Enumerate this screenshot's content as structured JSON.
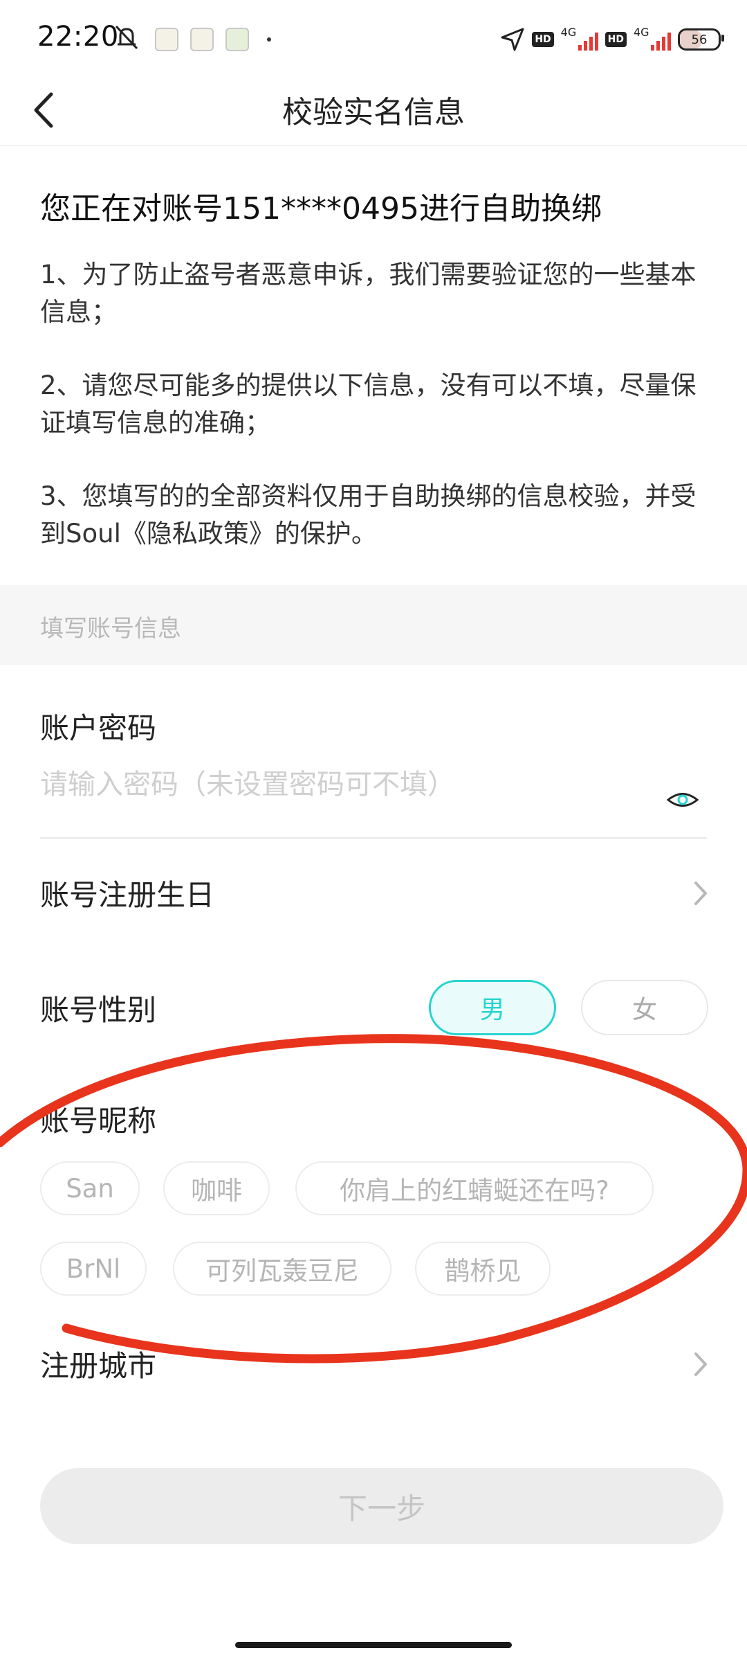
{
  "status_bar": {
    "time": "22:20",
    "network_left": "4G",
    "network_right": "4G",
    "hd": "HD",
    "battery": "56",
    "icons": [
      "mute-icon",
      "app-notification-icon",
      "location-arrow-icon",
      "signal-icon",
      "battery-icon"
    ]
  },
  "nav": {
    "title": "校验实名信息",
    "back_icon": "chevron-left-icon"
  },
  "intro": {
    "title": "您正在对账号151****0495进行自助换绑",
    "paragraphs": [
      "1、为了防止盗号者恶意申诉，我们需要验证您的一些基本信息；",
      "2、请您尽可能多的提供以下信息，没有可以不填，尽量保证填写信息的准确；",
      "3、您填写的的全部资料仅用于自助换绑的信息校验，并受到Soul《隐私政策》的保护。"
    ]
  },
  "section": {
    "label": "填写账号信息"
  },
  "password": {
    "label": "账户密码",
    "placeholder": "请输入密码（未设置密码可不填）",
    "value": ""
  },
  "birthday": {
    "label": "账号注册生日"
  },
  "gender": {
    "label": "账号性别",
    "options": [
      "男",
      "女"
    ],
    "selected": "男"
  },
  "nickname": {
    "label": "账号昵称",
    "options": [
      "San",
      "咖啡",
      "你肩上的红蜻蜓还在吗?",
      "BrNl",
      "可列瓦轰豆尼",
      "鹊桥见"
    ]
  },
  "city": {
    "label": "注册城市"
  },
  "next_button": {
    "label": "下一步"
  },
  "colors": {
    "accent": "#25d4d0",
    "accent_bg": "#e9fbfa",
    "annotation": "#e8341c",
    "disabled_button": "#ececec"
  }
}
